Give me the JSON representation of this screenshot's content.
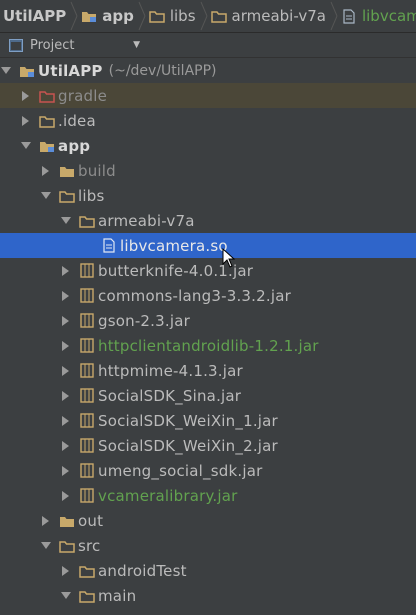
{
  "breadcrumb": [
    {
      "label": "UtilAPP",
      "icon": "project-icon"
    },
    {
      "label": "app",
      "icon": "module-folder-icon"
    },
    {
      "label": "libs",
      "icon": "folder-icon"
    },
    {
      "label": "armeabi-v7a",
      "icon": "folder-icon"
    },
    {
      "label": "libvcamera",
      "icon": "file-icon"
    }
  ],
  "toolbar": {
    "view_label": "Project"
  },
  "tree": {
    "root": {
      "label": "UtilAPP",
      "path": "(~/dev/UtilAPP)"
    },
    "gradle": "gradle",
    "idea": ".idea",
    "app": "app",
    "build": "build",
    "libs": "libs",
    "armeabi": "armeabi-v7a",
    "libvcamera": "libvcamera.so",
    "jars": [
      "butterknife-4.0.1.jar",
      "commons-lang3-3.3.2.jar",
      "gson-2.3.jar",
      "httpclientandroidlib-1.2.1.jar",
      "httpmime-4.1.3.jar",
      "SocialSDK_Sina.jar",
      "SocialSDK_WeiXin_1.jar",
      "SocialSDK_WeiXin_2.jar",
      "umeng_social_sdk.jar",
      "vcameralibrary.jar"
    ],
    "out": "out",
    "src": "src",
    "androidTest": "androidTest",
    "main": "main"
  },
  "colors": {
    "selection": "#2f65ca",
    "green_text": "#62a24f",
    "folder": "#c8a96a",
    "jar": "#c8a96a"
  }
}
